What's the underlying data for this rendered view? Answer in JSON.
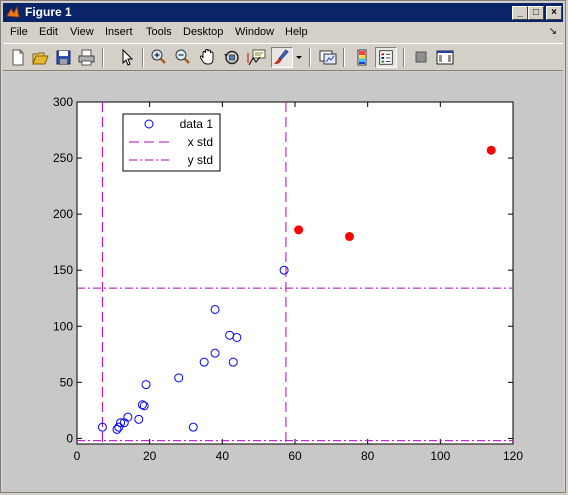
{
  "window": {
    "title": "Figure 1",
    "minimize": "_",
    "maximize": "□",
    "close": "×"
  },
  "menu": [
    "File",
    "Edit",
    "View",
    "Insert",
    "Tools",
    "Desktop",
    "Window",
    "Help"
  ],
  "toolbar": [
    "new-file",
    "open-file",
    "save",
    "print",
    "select-arrow",
    "zoom-in",
    "zoom-out",
    "pan",
    "rotate-3d",
    "data-cursor",
    "brush",
    "brush-dropdown",
    "link-plot",
    "colorbar",
    "legend",
    "hide-plot-tools",
    "show-plot-tools"
  ],
  "chart_data": {
    "type": "scatter",
    "xlim": [
      0,
      120
    ],
    "ylim": [
      -5,
      300
    ],
    "xticks": [
      0,
      20,
      40,
      60,
      80,
      100,
      120
    ],
    "yticks": [
      0,
      50,
      100,
      150,
      200,
      250,
      300
    ],
    "series": [
      {
        "name": "data 1",
        "marker": "open-circle",
        "color": "#0000ff",
        "x": [
          7,
          11,
          11.5,
          12,
          13,
          14,
          17,
          18,
          18.5,
          19,
          28,
          32,
          35,
          38,
          38,
          42,
          43,
          44,
          57
        ],
        "y": [
          10,
          8,
          10,
          14,
          14,
          19,
          17,
          30,
          29,
          48,
          54,
          10,
          68,
          76,
          115,
          92,
          68,
          90,
          150
        ]
      },
      {
        "marker": "filled-circle",
        "color": "#ff0000",
        "x": [
          61,
          75,
          114
        ],
        "y": [
          186,
          180,
          257
        ]
      },
      {
        "name": "x std",
        "style": "dashed-vertical",
        "color": "#bf00bf",
        "x": [
          7,
          57.5
        ]
      },
      {
        "name": "y std",
        "style": "dashdot-horizontal",
        "color": "#bf00bf",
        "y": [
          134,
          -2
        ]
      }
    ],
    "legend": {
      "placement": "top-left",
      "entries": [
        "data 1",
        "x std",
        "y std"
      ]
    },
    "grid": false
  }
}
